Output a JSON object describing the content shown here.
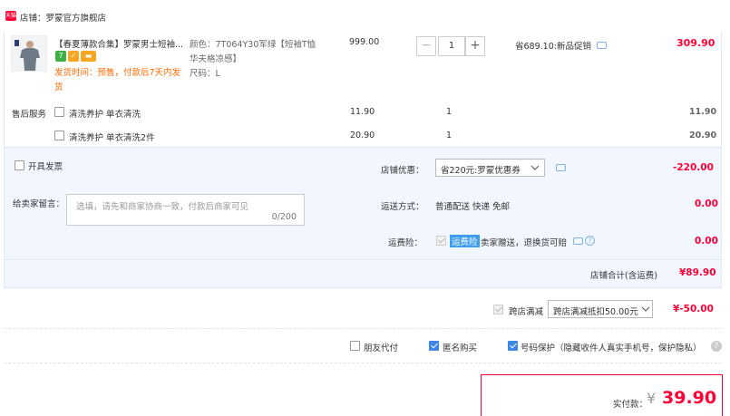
{
  "store": {
    "badge": "天猫",
    "name": "店铺：罗蒙官方旗舰店"
  },
  "item": {
    "title": "【春夏薄款合集】罗蒙男士短袖...",
    "delivery_note_line1": "发货时间：预售，付款后7天内发",
    "delivery_note_line2": "货",
    "attr_color_line1": "颜色：7T064Y30军绿【短袖T恤",
    "attr_color_line2": "华夫格凉感】",
    "attr_size": "尺码：L",
    "price": "999.00",
    "quantity": "1",
    "minus": "−",
    "plus": "+",
    "promo": "省689.10:新品促销",
    "subtotal": "309.90"
  },
  "services": {
    "label": "售后服务",
    "rows": [
      {
        "name": "清洗养护 单衣清洗",
        "price": "11.90",
        "qty": "1",
        "total": "11.90"
      },
      {
        "name": "清洗养护 单衣清洗2件",
        "price": "20.90",
        "qty": "1",
        "total": "20.90"
      }
    ]
  },
  "invoice": {
    "label": "开具发票"
  },
  "message": {
    "label": "给卖家留言：",
    "placeholder": "选填，请先和商家协商一致，付款后商家可见",
    "counter": "0/200"
  },
  "store_discount": {
    "label": "店铺优惠：",
    "selected": "省220元:罗蒙优惠券",
    "value": "-220.00"
  },
  "shipping": {
    "label": "运送方式：",
    "method": "普通配送 快递 免邮",
    "value": "0.00"
  },
  "freight_insurance": {
    "label": "运费险：",
    "tag": "运费险",
    "text": "卖家赠送，退换货可赔",
    "value": "0.00"
  },
  "store_total": {
    "label": "店铺合计(含运费)",
    "value": "¥89.90"
  },
  "cross_store": {
    "label": "跨店满减",
    "selected": "跨店满减抵扣50.00元",
    "value": "¥-50.00"
  },
  "options": {
    "friend_pay": "朋友代付",
    "anonymous": "匿名购买",
    "number_protect": "号码保护（隐藏收件人真实手机号，保护隐私）"
  },
  "payment": {
    "label": "实付款：",
    "currency": "¥",
    "amount": "39.90"
  },
  "colors": {
    "accent": "#ff0036",
    "orange": "#ff6a00",
    "blue_check": "#3c87e6",
    "section_bg": "#f2f7ff"
  }
}
